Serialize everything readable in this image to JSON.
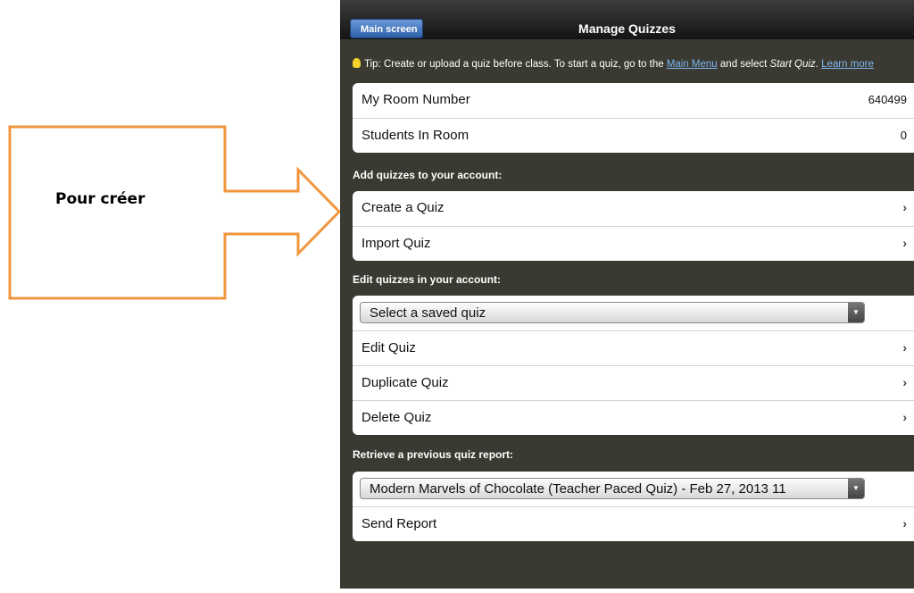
{
  "annotation": {
    "label": "Pour créer"
  },
  "navbar": {
    "back_label": "Main screen",
    "title": "Manage Quizzes"
  },
  "tip": {
    "prefix": "Tip: Create or upload a quiz before class. To start a quiz, go to the ",
    "main_menu_link": "Main Menu",
    "middle": " and select ",
    "start_quiz": "Start Quiz",
    "period": ". ",
    "learn_more_link": "Learn more"
  },
  "room": {
    "rows": [
      {
        "label": "My Room Number",
        "value": "640499"
      },
      {
        "label": "Students In Room",
        "value": "0"
      }
    ]
  },
  "add_section": {
    "heading": "Add quizzes to your account:",
    "rows": [
      {
        "label": "Create a Quiz"
      },
      {
        "label": "Import Quiz"
      }
    ]
  },
  "edit_section": {
    "heading": "Edit quizzes in your account:",
    "select_value": "Select a saved quiz",
    "rows": [
      {
        "label": "Edit Quiz"
      },
      {
        "label": "Duplicate Quiz"
      },
      {
        "label": "Delete Quiz"
      }
    ]
  },
  "report_section": {
    "heading": "Retrieve a previous quiz report:",
    "select_value": "Modern Marvels of Chocolate (Teacher Paced Quiz) - Feb 27, 2013 11",
    "rows": [
      {
        "label": "Send Report"
      }
    ]
  },
  "colors": {
    "callout": "#f0963c",
    "panel_bg": "#3a3a32",
    "link": "#7fb6f0"
  },
  "icons": {
    "row_chevron": "chevron-right-icon",
    "select_arrow": "dropdown-arrow-icon",
    "tip": "lightbulb-icon"
  }
}
